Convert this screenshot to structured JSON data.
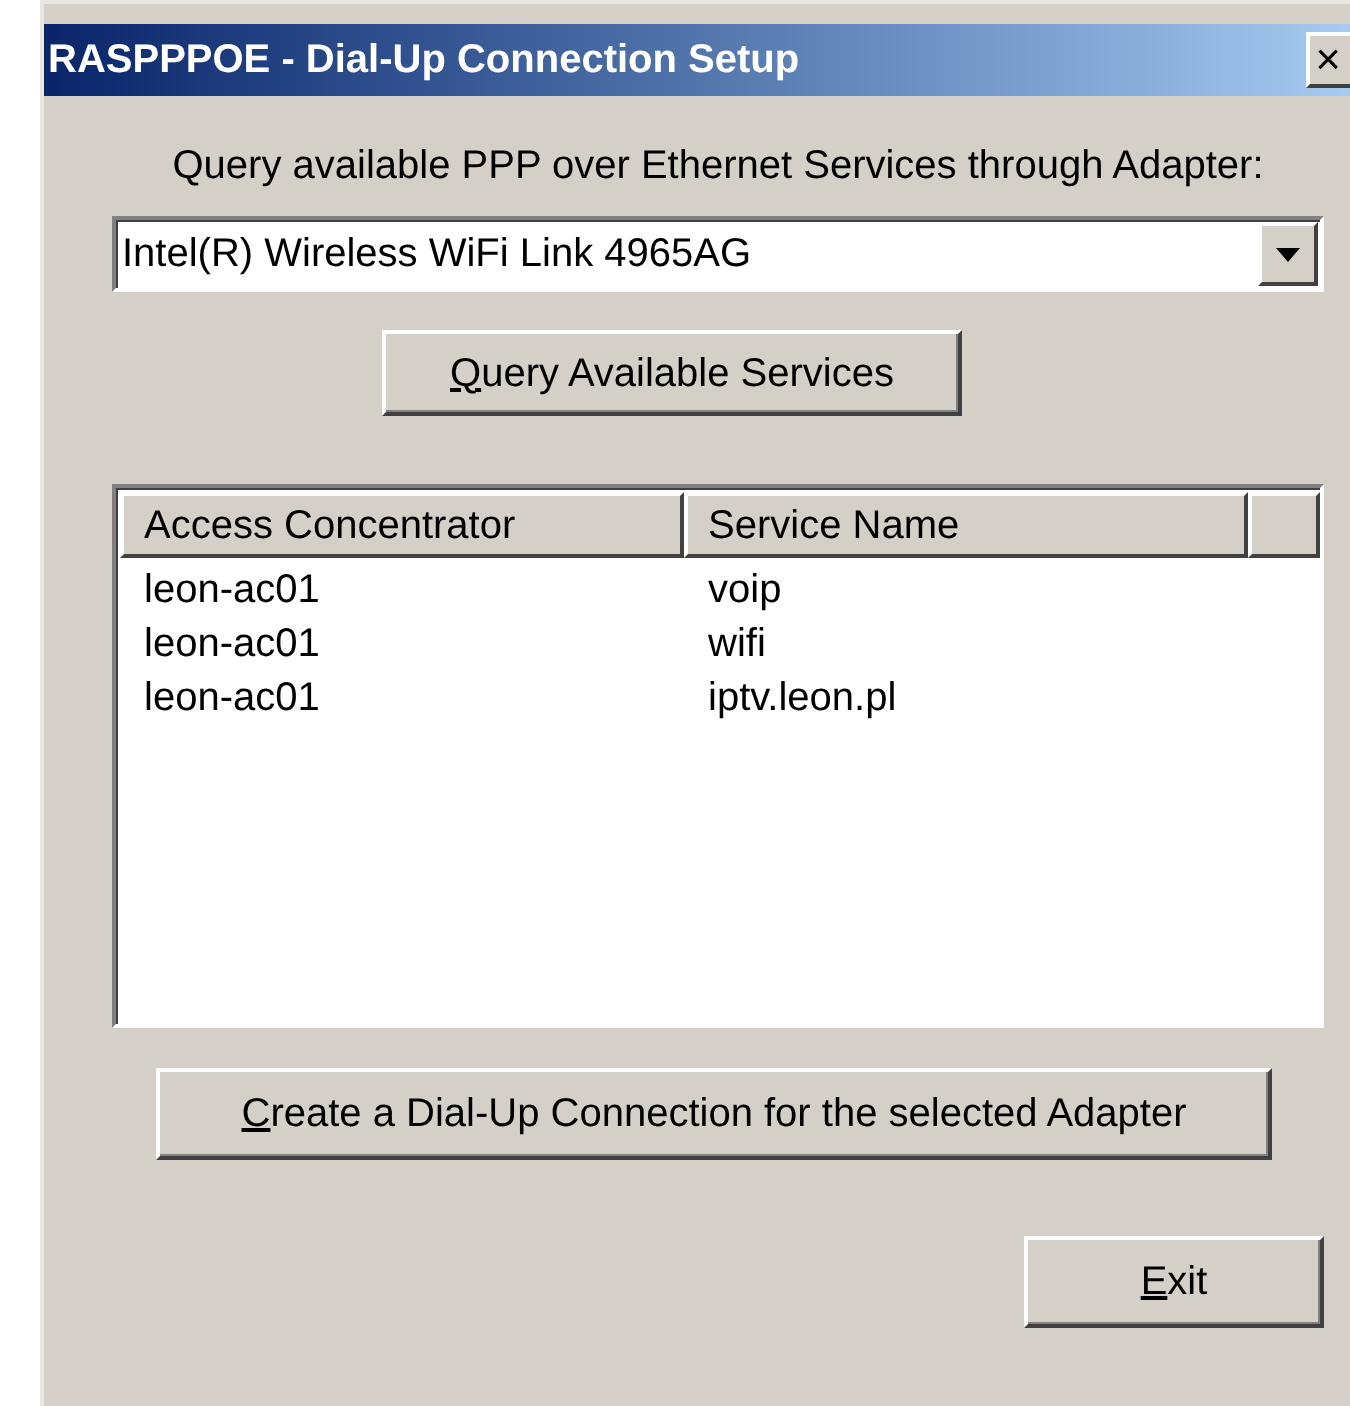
{
  "window": {
    "title": "RASPPPOE - Dial-Up Connection Setup",
    "close_button": "×"
  },
  "adapter": {
    "label": "Query available PPP over Ethernet Services through Adapter:",
    "value": "Intel(R) Wireless WiFi Link 4965AG"
  },
  "query_button": {
    "label": "Query Available Services",
    "underlined_first_letter": true
  },
  "table": {
    "columns": [
      "Access Concentrator",
      "Service Name"
    ],
    "rows": [
      [
        "leon-ac01",
        "voip"
      ],
      [
        "leon-ac01",
        "wifi"
      ],
      [
        "leon-ac01",
        "iptv.leon.pl"
      ]
    ]
  },
  "create_button": {
    "label": "Create a Dial-Up Connection for the selected Adapter",
    "underlined_first_letter": true
  },
  "exit_button": {
    "label": "Exit",
    "underlined_first_letter": true
  }
}
